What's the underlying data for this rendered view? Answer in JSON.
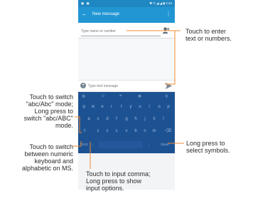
{
  "status_bar": {
    "left_icons": "▣ ▣",
    "right_icons": "✱ ℕ ◢ ◢ ▮ 2:34"
  },
  "app_bar": {
    "back_icon": "arrow-left-icon",
    "title": "New message",
    "menu_icon": "more-vert-icon"
  },
  "recipient": {
    "placeholder": "Type name or number",
    "contact_icon": "person-add-icon"
  },
  "compose": {
    "plus_icon": "+",
    "placeholder": "Type text message",
    "send_icon": "send-icon"
  },
  "keyboard": {
    "top_row": [
      "⚙",
      "☺",
      "⌖",
      "✥",
      "⚲"
    ],
    "row1": [
      "q",
      "w",
      "e",
      "r",
      "t",
      "y",
      "u",
      "i",
      "o",
      "p"
    ],
    "row2": [
      "a",
      "s",
      "d",
      "f",
      "g",
      "h",
      "j",
      "k",
      "l"
    ],
    "row3": [
      "⇧",
      "z",
      "x",
      "c",
      "v",
      "b",
      "n",
      "m",
      "⌫"
    ],
    "row4": {
      "left": "?123",
      "comma": ",",
      "period": ".",
      "done": "Done"
    }
  },
  "annotations": {
    "enter_text": [
      "Touch to enter",
      "text or numbers."
    ],
    "switch_mode": [
      "Touch to switch",
      "\"abc/Abc\" mode;",
      "Long press to",
      "switch \"abc/ABC\"",
      "mode."
    ],
    "switch_keyboard": [
      "Touch to switch",
      "between numeric",
      "keyboard and",
      "alphabetic on MS."
    ],
    "symbols": [
      "Long press to",
      "select symbols."
    ],
    "comma": [
      "Touch to input comma;",
      "Long press to show",
      "input options."
    ]
  },
  "colors": {
    "accent": "#2196d3",
    "keyboard": "#1d5292",
    "leader": "#f28b30"
  }
}
